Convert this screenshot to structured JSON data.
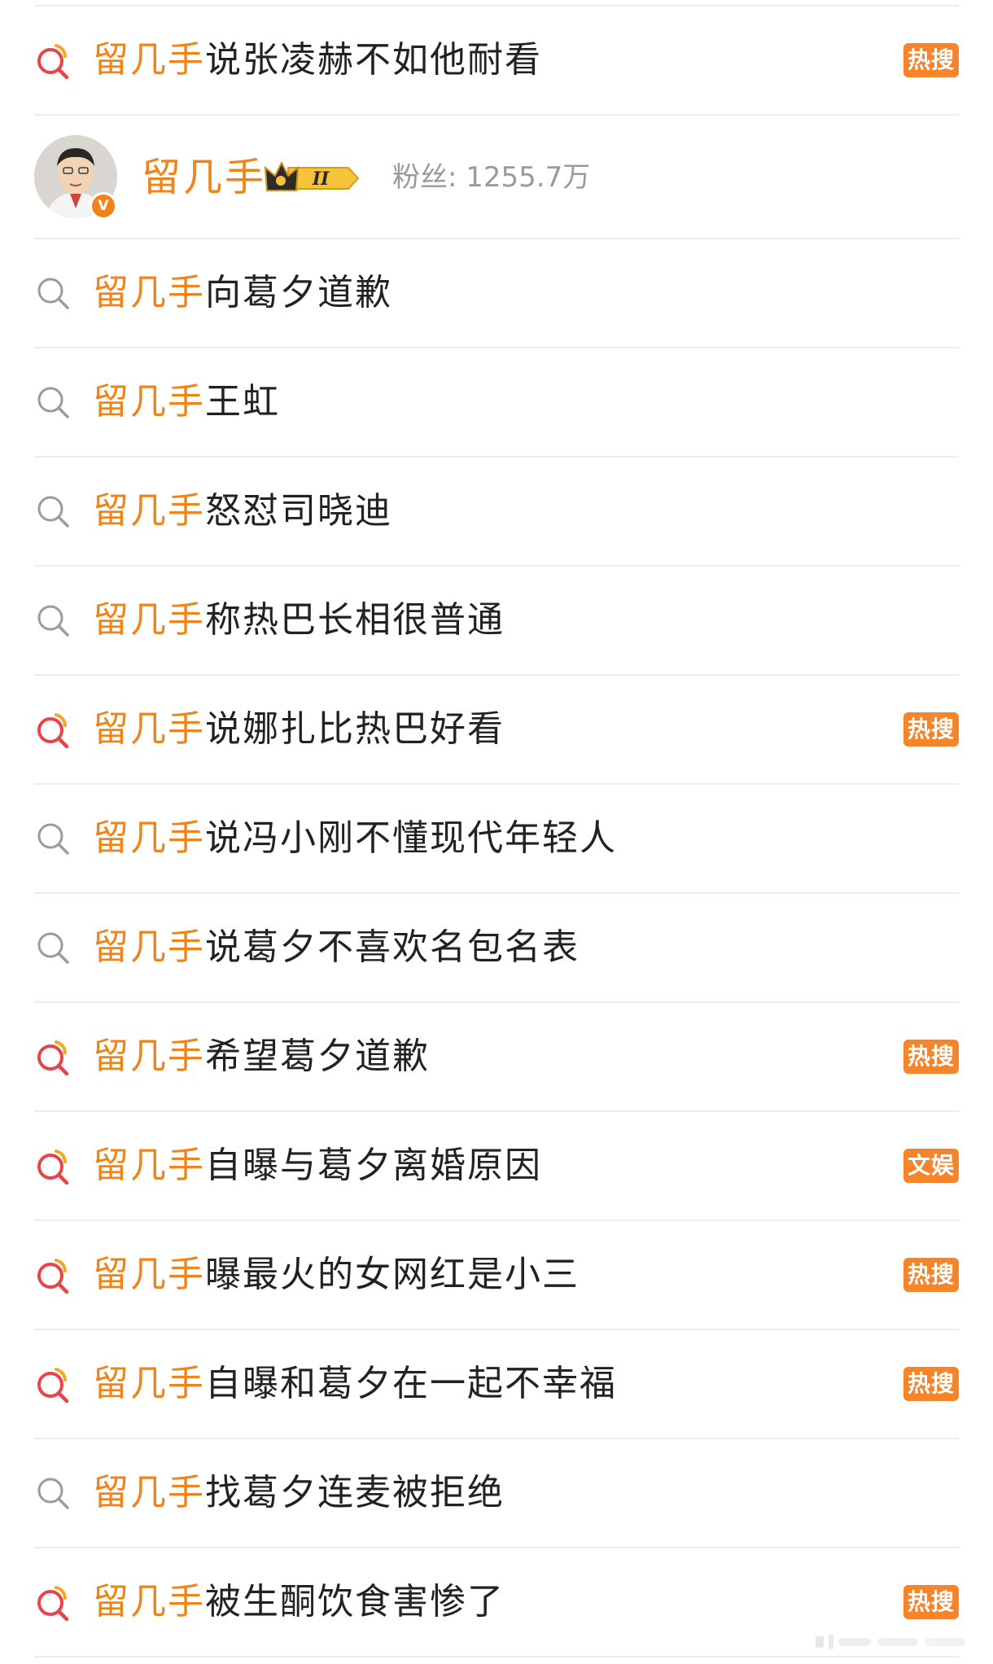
{
  "colors": {
    "keyword": "#f08418",
    "text": "#222222",
    "badge_bg": "#f5842b",
    "divider": "#ececec",
    "muted": "#9a9a9a",
    "hot_icon_red": "#e8454a",
    "hot_icon_orange": "#f5a623",
    "plain_icon_gray": "#9b9b9b"
  },
  "items": [
    {
      "keyword": "留几手",
      "text": "说张凌赫不如他耐看",
      "badge": "热搜",
      "icon": "hot-search-icon"
    },
    {
      "keyword": "留几手",
      "text": "向葛夕道歉",
      "badge": "",
      "icon": "search-icon"
    },
    {
      "keyword": "留几手",
      "text": "王虹",
      "badge": "",
      "icon": "search-icon"
    },
    {
      "keyword": "留几手",
      "text": "怒怼司晓迪",
      "badge": "",
      "icon": "search-icon"
    },
    {
      "keyword": "留几手",
      "text": "称热巴长相很普通",
      "badge": "",
      "icon": "search-icon"
    },
    {
      "keyword": "留几手",
      "text": "说娜扎比热巴好看",
      "badge": "热搜",
      "icon": "hot-search-icon"
    },
    {
      "keyword": "留几手",
      "text": "说冯小刚不懂现代年轻人",
      "badge": "",
      "icon": "search-icon"
    },
    {
      "keyword": "留几手",
      "text": "说葛夕不喜欢名包名表",
      "badge": "",
      "icon": "search-icon"
    },
    {
      "keyword": "留几手",
      "text": "希望葛夕道歉",
      "badge": "热搜",
      "icon": "hot-search-icon"
    },
    {
      "keyword": "留几手",
      "text": "自曝与葛夕离婚原因",
      "badge": "文娱",
      "icon": "hot-search-icon"
    },
    {
      "keyword": "留几手",
      "text": "曝最火的女网红是小三",
      "badge": "热搜",
      "icon": "hot-search-icon"
    },
    {
      "keyword": "留几手",
      "text": "自曝和葛夕在一起不幸福",
      "badge": "热搜",
      "icon": "hot-search-icon"
    },
    {
      "keyword": "留几手",
      "text": "找葛夕连麦被拒绝",
      "badge": "",
      "icon": "search-icon"
    },
    {
      "keyword": "留几手",
      "text": "被生酮饮食害惨了",
      "badge": "热搜",
      "icon": "hot-search-icon"
    }
  ],
  "user": {
    "name": "留几手",
    "vip_level": "II",
    "verified_mark": "V",
    "followers": "粉丝: 1255.7万",
    "icons": [
      "avatar",
      "verified-badge-icon",
      "crown-icon"
    ]
  }
}
